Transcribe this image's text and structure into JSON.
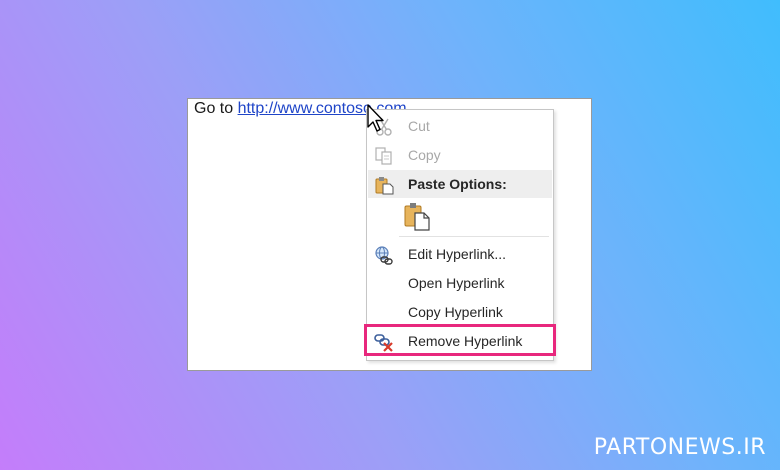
{
  "document": {
    "prefix_text": "Go to ",
    "link_text": "http://www.contoso.com"
  },
  "context_menu": {
    "items": [
      {
        "label": "Cut",
        "icon": "scissors-icon",
        "enabled": false
      },
      {
        "label": "Copy",
        "icon": "copy-icon",
        "enabled": false
      },
      {
        "label": "Paste Options:",
        "icon": "paste-icon",
        "enabled": true
      },
      {
        "label": "Edit Hyperlink...",
        "icon": "globe-link-icon",
        "enabled": true
      },
      {
        "label": "Open Hyperlink",
        "icon": "",
        "enabled": true
      },
      {
        "label": "Copy Hyperlink",
        "icon": "",
        "enabled": true
      },
      {
        "label": "Remove Hyperlink",
        "icon": "unlink-icon",
        "enabled": true
      }
    ],
    "highlight_color": "#e8277d"
  },
  "watermark": "PARTONEWS.IR"
}
